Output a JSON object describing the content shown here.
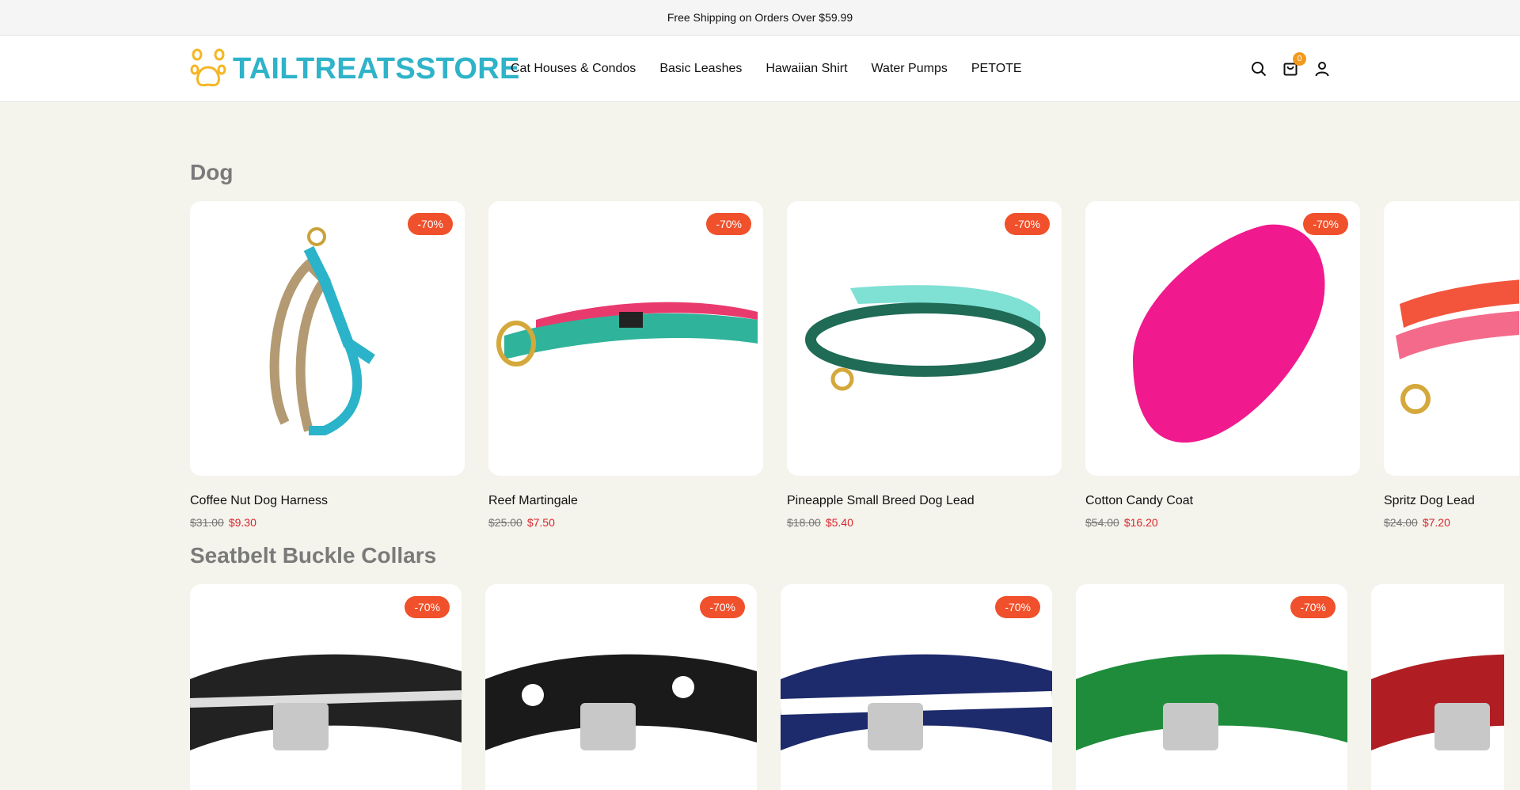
{
  "announcement": "Free Shipping on Orders Over $59.99",
  "brand": {
    "name": "TAILTREATSSTORE",
    "color": "#2fb3c9",
    "logo_icon": "paw-icon"
  },
  "nav": {
    "items": [
      "Cat Houses & Condos",
      "Basic Leashes",
      "Hawaiian Shirt",
      "Water Pumps",
      "PETOTE"
    ]
  },
  "header_icons": {
    "search": "search-icon",
    "cart": "cart-icon",
    "cart_count": "0",
    "account": "user-icon"
  },
  "sections": [
    {
      "title": "Dog",
      "products": [
        {
          "name": "Coffee Nut Dog Harness",
          "old_price": "$31.00",
          "price": "$9.30",
          "discount": "-70%"
        },
        {
          "name": "Reef Martingale",
          "old_price": "$25.00",
          "price": "$7.50",
          "discount": "-70%"
        },
        {
          "name": "Pineapple Small Breed Dog Lead",
          "old_price": "$18.00",
          "price": "$5.40",
          "discount": "-70%"
        },
        {
          "name": "Cotton Candy Coat",
          "old_price": "$54.00",
          "price": "$16.20",
          "discount": "-70%"
        },
        {
          "name": "Spritz Dog Lead",
          "old_price": "$24.00",
          "price": "$7.20",
          "discount": ""
        }
      ]
    },
    {
      "title": "Seatbelt Buckle Collars",
      "products": [
        {
          "discount": "-70%"
        },
        {
          "discount": "-70%"
        },
        {
          "discount": "-70%"
        },
        {
          "discount": "-70%"
        },
        {
          "discount": ""
        }
      ]
    }
  ],
  "colors": {
    "accent": "#2fb3c9",
    "sale": "#d8262b",
    "badge": "#f0502b",
    "cart_badge": "#f29a1d",
    "background": "#f4f3ec"
  }
}
